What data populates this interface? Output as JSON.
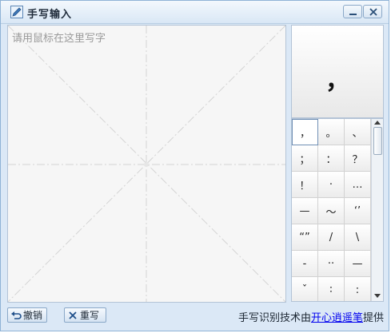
{
  "window": {
    "title": "手写输入",
    "minimize_label": "_",
    "close_label": "×"
  },
  "canvas": {
    "placeholder": "请用鼠标在这里写字"
  },
  "preview": {
    "char": "，"
  },
  "candidates": [
    "，",
    "。",
    "、",
    "；",
    "：",
    "？",
    "！",
    "·",
    "…",
    "—",
    "～",
    "‘’",
    "“”",
    "/",
    "\\",
    "-",
    "··",
    "—",
    "ˇ",
    "∶",
    ":"
  ],
  "toolbar": {
    "undo_label": "撤销",
    "rewrite_label": "重写"
  },
  "credit": {
    "prefix": "手写识别技术由",
    "link": "开心逍遥笔",
    "suffix": "提供"
  },
  "colors": {
    "window_bg": "#dbe8f6",
    "border": "#8fb3d6",
    "link": "#0000ee"
  }
}
